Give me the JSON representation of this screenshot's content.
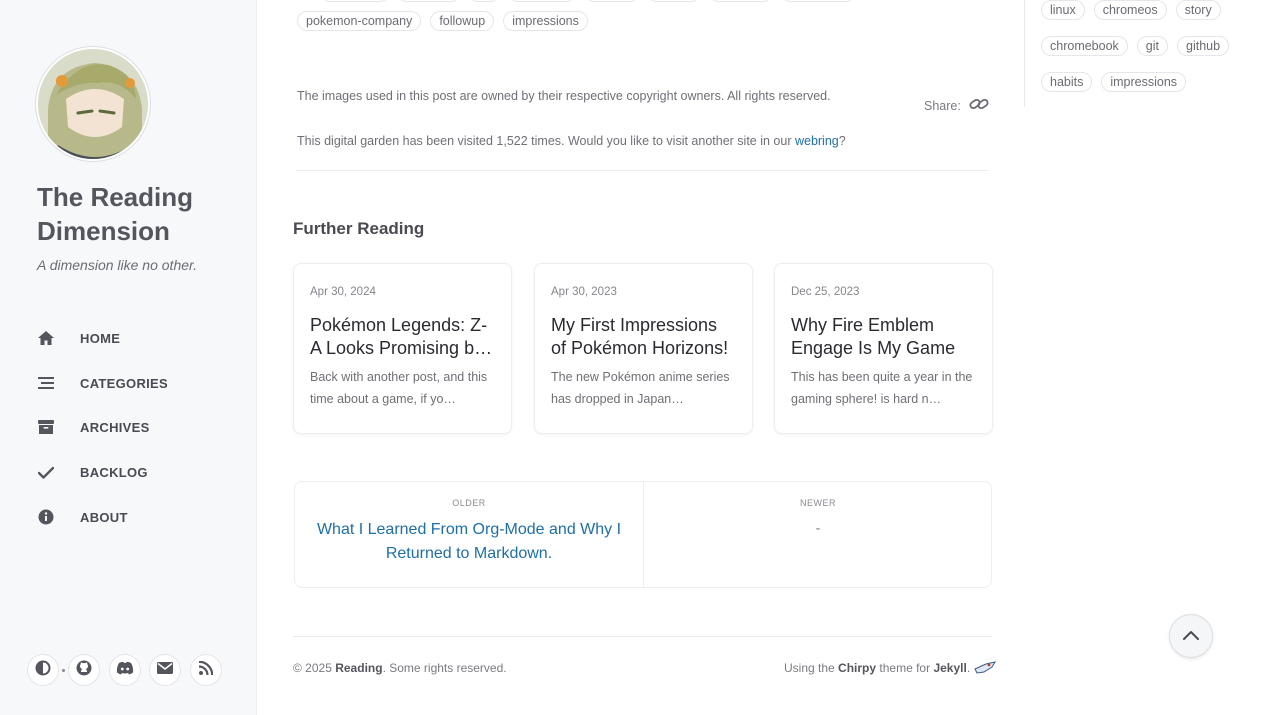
{
  "sidebar": {
    "title": "The Reading Dimension",
    "subtitle": "A dimension like no other.",
    "nav": [
      {
        "label": "HOME",
        "icon": "home-icon"
      },
      {
        "label": "CATEGORIES",
        "icon": "stream-icon"
      },
      {
        "label": "ARCHIVES",
        "icon": "archive-icon"
      },
      {
        "label": "BACKLOG",
        "icon": "check-icon"
      },
      {
        "label": "ABOUT",
        "icon": "info-circle-icon"
      }
    ],
    "bottom_icons": [
      "theme-toggle-icon",
      "github-icon",
      "discord-icon",
      "email-icon",
      "rss-icon"
    ]
  },
  "post": {
    "tags": [
      "pokemon-company",
      "followup",
      "impressions"
    ],
    "copyright_note": "The images used in this post are owned by their respective copyright owners. All rights reserved.",
    "share_label": "Share:",
    "visit_prefix": "This digital garden has been visited 1,522 times. Would you like to visit another site in our ",
    "visit_link": "webring",
    "visit_suffix": "?"
  },
  "panel_tags": {
    "row1": [
      "linux",
      "chromeos",
      "story"
    ],
    "row2": [
      "chromebook",
      "git",
      "github"
    ],
    "row3": [
      "habits",
      "impressions"
    ]
  },
  "further_reading": {
    "title": "Further Reading",
    "cards": [
      {
        "date": "Apr 30, 2024",
        "title": "Pokémon Legends: Z-A Looks Promising b…",
        "excerpt": "Back with another post, and this time about a game, if yo…"
      },
      {
        "date": "Apr 30, 2023",
        "title": "My First Impressions of Pokémon Horizons!",
        "excerpt": "The new Pokémon anime series has dropped in Japan…"
      },
      {
        "date": "Dec 25, 2023",
        "title": "Why Fire Emblem Engage Is My Game …",
        "excerpt": "This has been quite a year in the gaming sphere! is hard n…"
      }
    ]
  },
  "post_nav": {
    "older_label": "OLDER",
    "older_title": "What I Learned From Org-Mode and Why I Returned to Markdown.",
    "newer_label": "NEWER",
    "newer_title": "-"
  },
  "footer": {
    "copyright_prefix": "© 2025 ",
    "site_name": "Reading",
    "copyright_suffix": ". Some rights reserved.",
    "using": "Using the ",
    "theme": "Chirpy",
    "theme_for": " theme for ",
    "jekyll": "Jekyll",
    "period": "."
  },
  "colors": {
    "sidebar_bg": "#f6f8fa",
    "link": "#1d6fa8",
    "heading": "#4a4a52"
  }
}
